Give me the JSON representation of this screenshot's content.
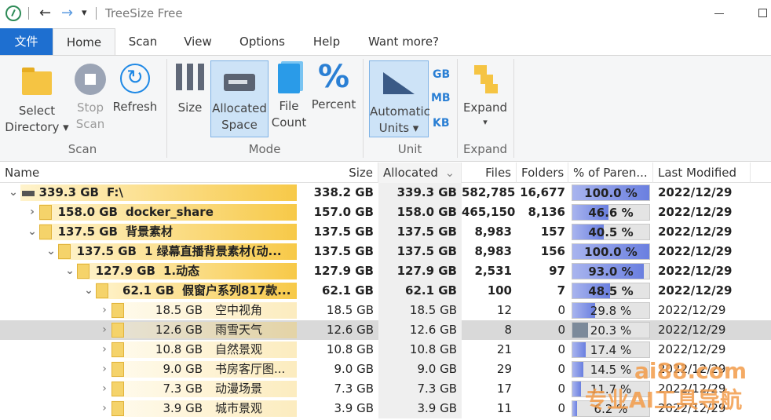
{
  "titlebar": {
    "title": "TreeSize Free"
  },
  "tabs": [
    {
      "label": "文件"
    },
    {
      "label": "Home"
    },
    {
      "label": "Scan"
    },
    {
      "label": "View"
    },
    {
      "label": "Options"
    },
    {
      "label": "Help"
    },
    {
      "label": "Want more?"
    }
  ],
  "ribbon": {
    "select_directory": {
      "line1": "Select",
      "line2": "Directory ▾"
    },
    "stop_scan": {
      "line1": "Stop",
      "line2": "Scan"
    },
    "refresh": {
      "line1": "Refresh"
    },
    "size": {
      "line1": "Size"
    },
    "allocated_space": {
      "line1": "Allocated",
      "line2": "Space"
    },
    "file_count": {
      "line1": "File",
      "line2": "Count"
    },
    "percent": {
      "line1": "Percent",
      "icon": "%"
    },
    "automatic_units": {
      "line1": "Automatic",
      "line2": "Units ▾"
    },
    "unit_gb": "GB",
    "unit_mb": "MB",
    "unit_kb": "KB",
    "expand": {
      "line1": "Expand",
      "line2": "▾"
    },
    "groups": {
      "scan": "Scan",
      "mode": "Mode",
      "unit": "Unit",
      "expand": "Expand"
    }
  },
  "columns": {
    "name": "Name",
    "size": "Size",
    "allocated": "Allocated",
    "allocated_sort": "⌄",
    "files": "Files",
    "folders": "Folders",
    "percent": "% of Paren...",
    "modified": "Last Modified"
  },
  "rows": [
    {
      "expander": "⌄",
      "sizelabel": "339.3 GB",
      "name": "F:\\",
      "size": "338.2 GB",
      "allocated": "339.3 GB",
      "files": "582,785",
      "folders": "16,677",
      "percent": "100.0 %",
      "pct": 100,
      "modified": "2022/12/29",
      "bold": true
    },
    {
      "expander": "›",
      "sizelabel": "158.0 GB",
      "name": "docker_share",
      "size": "157.0 GB",
      "allocated": "158.0 GB",
      "files": "465,150",
      "folders": "8,136",
      "percent": "46.6 %",
      "pct": 46.6,
      "modified": "2022/12/29",
      "bold": true
    },
    {
      "expander": "⌄",
      "sizelabel": "137.5 GB",
      "name": "背景素材",
      "size": "137.5 GB",
      "allocated": "137.5 GB",
      "files": "8,983",
      "folders": "157",
      "percent": "40.5 %",
      "pct": 40.5,
      "modified": "2022/12/29",
      "bold": true
    },
    {
      "expander": "⌄",
      "sizelabel": "137.5 GB",
      "name": "1 绿幕直播背景素材(动...",
      "size": "137.5 GB",
      "allocated": "137.5 GB",
      "files": "8,983",
      "folders": "156",
      "percent": "100.0 %",
      "pct": 100,
      "modified": "2022/12/29",
      "bold": true
    },
    {
      "expander": "⌄",
      "sizelabel": "127.9 GB",
      "name": "1.动态",
      "size": "127.9 GB",
      "allocated": "127.9 GB",
      "files": "2,531",
      "folders": "97",
      "percent": "93.0 %",
      "pct": 93,
      "modified": "2022/12/29",
      "bold": true
    },
    {
      "expander": "⌄",
      "sizelabel": "62.1 GB",
      "name": "假窗户系列817款...",
      "size": "62.1 GB",
      "allocated": "62.1 GB",
      "files": "100",
      "folders": "7",
      "percent": "48.5 %",
      "pct": 48.5,
      "modified": "2022/12/29",
      "bold": true
    },
    {
      "expander": "›",
      "sizelabel": "18.5 GB",
      "name": "空中视角",
      "size": "18.5 GB",
      "allocated": "18.5 GB",
      "files": "12",
      "folders": "0",
      "percent": "29.8 %",
      "pct": 29.8,
      "modified": "2022/12/29",
      "bold": false
    },
    {
      "expander": "›",
      "sizelabel": "12.6 GB",
      "name": "雨雪天气",
      "size": "12.6 GB",
      "allocated": "12.6 GB",
      "files": "8",
      "folders": "0",
      "percent": "20.3 %",
      "pct": 20.3,
      "modified": "2022/12/29",
      "bold": false,
      "selected": true
    },
    {
      "expander": "›",
      "sizelabel": "10.8 GB",
      "name": "自然景观",
      "size": "10.8 GB",
      "allocated": "10.8 GB",
      "files": "21",
      "folders": "0",
      "percent": "17.4 %",
      "pct": 17.4,
      "modified": "2022/12/29",
      "bold": false
    },
    {
      "expander": "›",
      "sizelabel": "9.0 GB",
      "name": "书房客厅图...",
      "size": "9.0 GB",
      "allocated": "9.0 GB",
      "files": "29",
      "folders": "0",
      "percent": "14.5 %",
      "pct": 14.5,
      "modified": "2022/12/29",
      "bold": false
    },
    {
      "expander": "›",
      "sizelabel": "7.3 GB",
      "name": "动漫场景",
      "size": "7.3 GB",
      "allocated": "7.3 GB",
      "files": "17",
      "folders": "0",
      "percent": "11.7 %",
      "pct": 11.7,
      "modified": "2022/12/29",
      "bold": false
    },
    {
      "expander": "›",
      "sizelabel": "3.9 GB",
      "name": "城市景观",
      "size": "3.9 GB",
      "allocated": "3.9 GB",
      "files": "11",
      "folders": "0",
      "percent": "6.2 %",
      "pct": 6.2,
      "modified": "2022/12/29",
      "bold": false
    }
  ],
  "watermark": {
    "line1": "ai88.com",
    "line2": "专业AI工具导航"
  }
}
